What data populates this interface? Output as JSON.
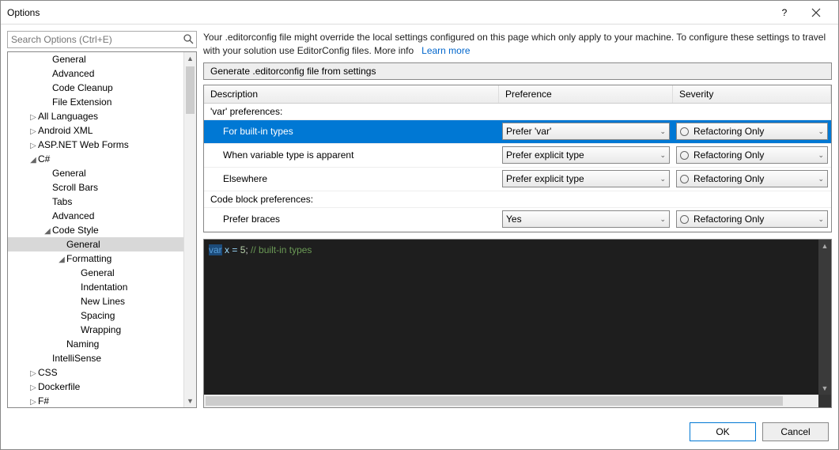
{
  "window": {
    "title": "Options"
  },
  "search": {
    "placeholder": "Search Options (Ctrl+E)"
  },
  "tree": [
    {
      "label": "General",
      "indent": 2,
      "exp": ""
    },
    {
      "label": "Advanced",
      "indent": 2,
      "exp": ""
    },
    {
      "label": "Code Cleanup",
      "indent": 2,
      "exp": ""
    },
    {
      "label": "File Extension",
      "indent": 2,
      "exp": ""
    },
    {
      "label": "All Languages",
      "indent": 1,
      "exp": "▷"
    },
    {
      "label": "Android XML",
      "indent": 1,
      "exp": "▷"
    },
    {
      "label": "ASP.NET Web Forms",
      "indent": 1,
      "exp": "▷"
    },
    {
      "label": "C#",
      "indent": 1,
      "exp": "◢"
    },
    {
      "label": "General",
      "indent": 2,
      "exp": ""
    },
    {
      "label": "Scroll Bars",
      "indent": 2,
      "exp": ""
    },
    {
      "label": "Tabs",
      "indent": 2,
      "exp": ""
    },
    {
      "label": "Advanced",
      "indent": 2,
      "exp": ""
    },
    {
      "label": "Code Style",
      "indent": 2,
      "exp": "◢"
    },
    {
      "label": "General",
      "indent": 3,
      "exp": "",
      "selected": true
    },
    {
      "label": "Formatting",
      "indent": 3,
      "exp": "◢"
    },
    {
      "label": "General",
      "indent": 4,
      "exp": ""
    },
    {
      "label": "Indentation",
      "indent": 4,
      "exp": ""
    },
    {
      "label": "New Lines",
      "indent": 4,
      "exp": ""
    },
    {
      "label": "Spacing",
      "indent": 4,
      "exp": ""
    },
    {
      "label": "Wrapping",
      "indent": 4,
      "exp": ""
    },
    {
      "label": "Naming",
      "indent": 3,
      "exp": ""
    },
    {
      "label": "IntelliSense",
      "indent": 2,
      "exp": ""
    },
    {
      "label": "CSS",
      "indent": 1,
      "exp": "▷"
    },
    {
      "label": "Dockerfile",
      "indent": 1,
      "exp": "▷"
    },
    {
      "label": "F#",
      "indent": 1,
      "exp": "▷"
    }
  ],
  "info": {
    "text": "Your .editorconfig file might override the local settings configured on this page which only apply to your machine. To configure these settings to travel with your solution use EditorConfig files. More info",
    "link": "Learn more"
  },
  "genbutton": "Generate .editorconfig file from settings",
  "headers": {
    "desc": "Description",
    "pref": "Preference",
    "sev": "Severity"
  },
  "groups": [
    {
      "title": "'var' preferences:",
      "rows": [
        {
          "desc": "For built-in types",
          "pref": "Prefer 'var'",
          "sev": "Refactoring Only",
          "selected": true
        },
        {
          "desc": "When variable type is apparent",
          "pref": "Prefer explicit type",
          "sev": "Refactoring Only"
        },
        {
          "desc": "Elsewhere",
          "pref": "Prefer explicit type",
          "sev": "Refactoring Only"
        }
      ]
    },
    {
      "title": "Code block preferences:",
      "rows": [
        {
          "desc": "Prefer braces",
          "pref": "Yes",
          "sev": "Refactoring Only"
        }
      ]
    }
  ],
  "code": {
    "kw": "var",
    "rest": " x = ",
    "num": "5",
    "semi": ";",
    "comment": " // built-in types"
  },
  "footer": {
    "ok": "OK",
    "cancel": "Cancel"
  }
}
